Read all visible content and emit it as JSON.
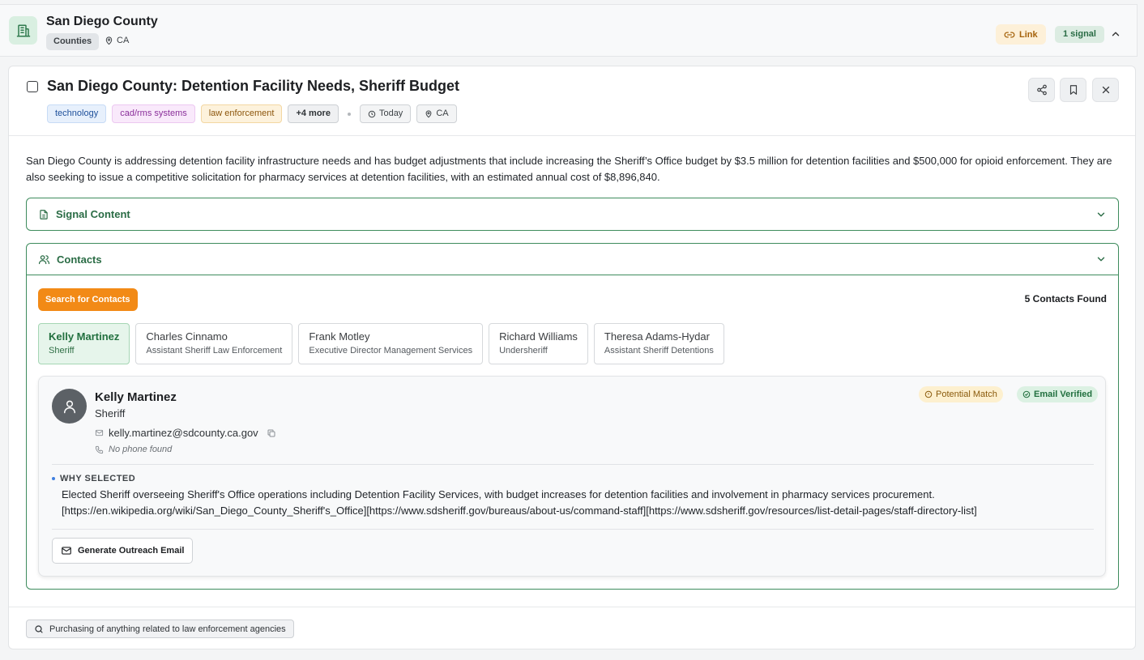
{
  "county": {
    "name": "San Diego County",
    "type": "Counties",
    "location": "CA",
    "link_label": "Link",
    "signal_count": "1 signal"
  },
  "signal": {
    "title": "San Diego County: Detention Facility Needs, Sheriff Budget",
    "tags": [
      "technology",
      "cad/rms systems",
      "law enforcement"
    ],
    "more_tags": "+4 more",
    "date": "Today",
    "location": "CA",
    "summary": "San Diego County is addressing detention facility infrastructure needs and has budget adjustments that include increasing the Sheriff’s Office budget by $3.5 million for detention facilities and $500,000 for opioid enforcement. They are also seeking to issue a competitive solicitation for pharmacy services at detention facilities, with an estimated annual cost of $8,896,840."
  },
  "sections": {
    "signal_content": "Signal Content",
    "contacts": "Contacts"
  },
  "contacts": {
    "search_label": "Search for Contacts",
    "found_label": "5 Contacts Found",
    "list": [
      {
        "name": "Kelly Martinez",
        "role": "Sheriff"
      },
      {
        "name": "Charles Cinnamo",
        "role": "Assistant Sheriff Law Enforcement"
      },
      {
        "name": "Frank Motley",
        "role": "Executive Director Management Services"
      },
      {
        "name": "Richard Williams",
        "role": "Undersheriff"
      },
      {
        "name": "Theresa Adams-Hydar",
        "role": "Assistant Sheriff Detentions"
      }
    ],
    "selected": {
      "name": "Kelly Martinez",
      "role": "Sheriff",
      "email": "kelly.martinez@sdcounty.ca.gov",
      "phone": "No phone found",
      "badge_match": "Potential Match",
      "badge_email": "Email Verified",
      "why_label": "WHY SELECTED",
      "why_text": "Elected Sheriff overseeing Sheriff's Office operations including Detention Facility Services, with budget increases for detention facilities and involvement in pharmacy services procurement. [https://en.wikipedia.org/wiki/San_Diego_County_Sheriff's_Office][https://www.sdsheriff.gov/bureaus/about-us/command-staff][https://www.sdsheriff.gov/resources/list-detail-pages/staff-directory-list]",
      "outreach_label": "Generate Outreach Email"
    }
  },
  "footer": {
    "query": "Purchasing of anything related to law enforcement agencies"
  },
  "colors": {
    "accent_green": "#3e8c5d",
    "search_orange": "#f28a16"
  }
}
